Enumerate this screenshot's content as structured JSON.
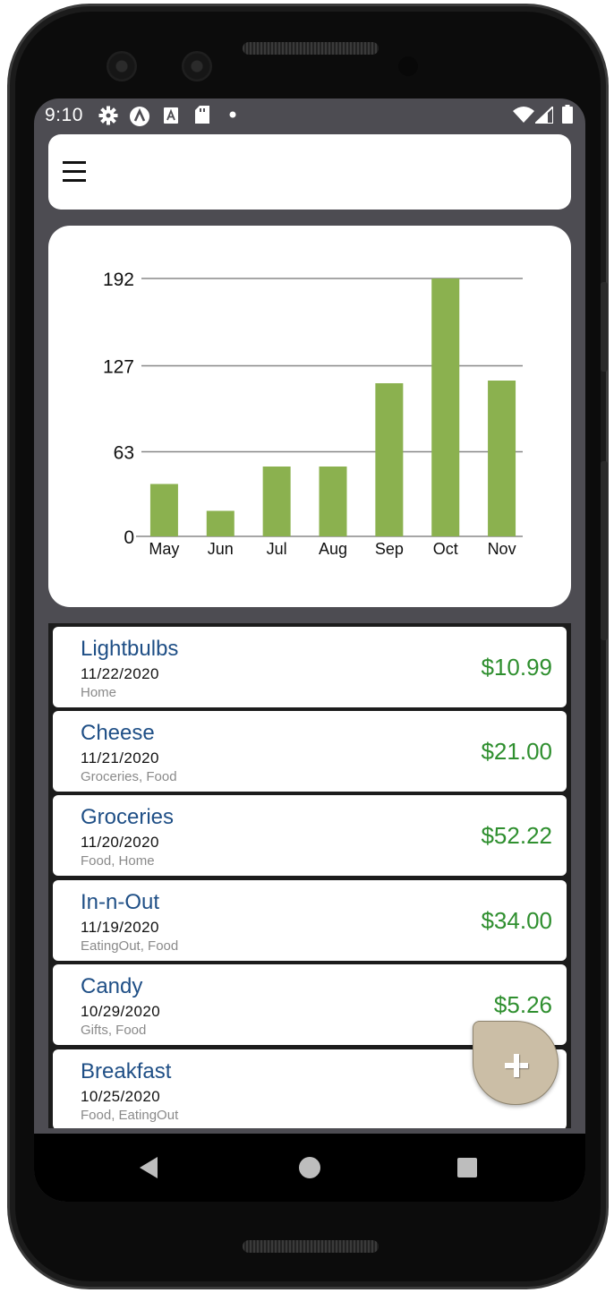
{
  "status_bar": {
    "time": "9:10",
    "left_icons": [
      "settings-gear-icon",
      "app-a-icon",
      "accessibility-a-icon",
      "sd-card-icon",
      "notification-dot-icon"
    ],
    "right_icons": [
      "wifi-icon",
      "cell-signal-icon",
      "battery-icon"
    ]
  },
  "app_bar": {
    "menu_icon": "hamburger-menu-icon"
  },
  "chart_data": {
    "type": "bar",
    "categories": [
      "May",
      "Jun",
      "Jul",
      "Aug",
      "Sep",
      "Oct",
      "Nov"
    ],
    "values": [
      39,
      19,
      52,
      52,
      114,
      192,
      116
    ],
    "y_ticks": [
      0,
      63,
      127,
      192
    ],
    "ylim": [
      0,
      192
    ],
    "bar_color": "#8bb14f",
    "grid": true,
    "title": "",
    "xlabel": "",
    "ylabel": ""
  },
  "transactions": [
    {
      "name": "Lightbulbs",
      "date": "11/22/2020",
      "tags": "Home",
      "amount": "$10.99"
    },
    {
      "name": "Cheese",
      "date": "11/21/2020",
      "tags": "Groceries, Food",
      "amount": "$21.00"
    },
    {
      "name": "Groceries",
      "date": "11/20/2020",
      "tags": "Food, Home",
      "amount": "$52.22"
    },
    {
      "name": "In-n-Out",
      "date": "11/19/2020",
      "tags": "EatingOut, Food",
      "amount": "$34.00"
    },
    {
      "name": "Candy",
      "date": "10/29/2020",
      "tags": "Gifts, Food",
      "amount": "$5.26"
    },
    {
      "name": "Breakfast",
      "date": "10/25/2020",
      "tags": "Food, EatingOut",
      "amount": ""
    }
  ],
  "fab": {
    "icon": "plus-icon"
  },
  "nav_bar": {
    "icons": [
      "back-icon",
      "home-icon",
      "recents-icon"
    ]
  },
  "colors": {
    "screen_bg": "#4d4c52",
    "item_name": "#1f4f86",
    "amount": "#2f8f2f",
    "fab": "#cbbea6"
  }
}
